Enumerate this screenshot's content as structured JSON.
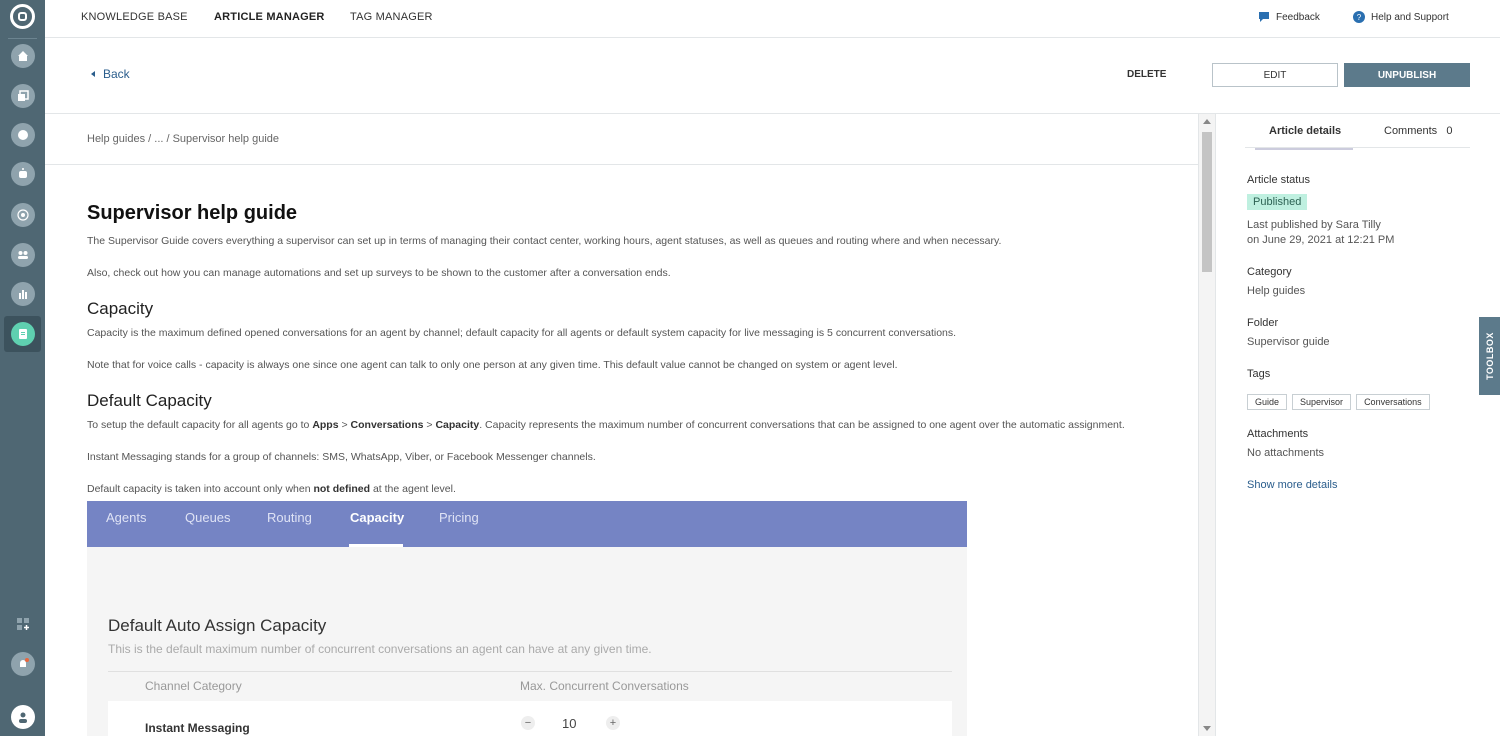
{
  "nav": {
    "tabs": [
      "KNOWLEDGE BASE",
      "ARTICLE MANAGER",
      "TAG MANAGER"
    ],
    "feedback": "Feedback",
    "help": "Help and Support"
  },
  "actions": {
    "back": "Back",
    "delete": "DELETE",
    "edit": "EDIT",
    "unpublish": "UNPUBLISH"
  },
  "breadcrumb": "Help guides / ... / Supervisor help guide",
  "article": {
    "title": "Supervisor help guide",
    "intro1": "The Supervisor Guide covers everything a supervisor can set up in terms of managing their contact center, working hours, agent statuses, as well as queues and routing where and when necessary.",
    "intro2": "Also, check out how you can manage automations and set up surveys to be shown to the customer after a conversation ends.",
    "h_capacity": "Capacity",
    "cap1": "Capacity is the maximum defined opened conversations for an agent by channel; default capacity for all agents or default system capacity for live messaging is 5 concurrent conversations.",
    "cap2": "Note that for voice calls - capacity is always one since one agent can talk to only one person at any given time. This default value cannot be changed on system or agent level.",
    "h_default": "Default Capacity",
    "def1_a": "To setup the default capacity for all agents go to ",
    "def1_apps": "Apps",
    "def1_gt1": " > ",
    "def1_conv": "Conversations",
    "def1_gt2": " > ",
    "def1_cap": "Capacity",
    "def1_b": ". Capacity represents the maximum number of concurrent conversations that can be assigned to one agent over the automatic assignment.",
    "def2": "Instant Messaging stands for a group of channels: SMS, WhatsApp, Viber, or Facebook Messenger channels.",
    "def3_a": "Default capacity is taken into account only when ",
    "def3_b": "not defined",
    "def3_c": " at the agent level."
  },
  "screenshot": {
    "tabs": [
      "Agents",
      "Queues",
      "Routing",
      "Capacity",
      "Pricing"
    ],
    "active_tab": "Capacity",
    "title": "Default Auto Assign Capacity",
    "subtitle": "This is the default maximum number of concurrent conversations an agent can have at any given time.",
    "col1": "Channel Category",
    "col2": "Max. Concurrent Conversations",
    "row_label": "Instant Messaging",
    "row_value": "10",
    "minus": "−",
    "plus": "+"
  },
  "panel": {
    "tab_details": "Article details",
    "tab_comments": "Comments",
    "comments_count": "0",
    "status_label": "Article status",
    "status": "Published",
    "published_by": "Last published by Sara Tilly",
    "published_on": "on June 29, 2021 at 12:21 PM",
    "category_label": "Category",
    "category": "Help guides",
    "folder_label": "Folder",
    "folder": "Supervisor guide",
    "tags_label": "Tags",
    "tags": [
      "Guide",
      "Supervisor",
      "Conversations"
    ],
    "attachments_label": "Attachments",
    "attachments": "No attachments",
    "show_more": "Show more details"
  },
  "toolbox": "TOOLBOX",
  "colors": {
    "rail": "#4f6773",
    "accent": "#5c7a8b",
    "link": "#2a5d8c",
    "published_bg": "#bff0e0"
  },
  "rail_icons": [
    "home-icon",
    "copy-icon",
    "chat-icon",
    "bot-icon",
    "network-icon",
    "people-icon",
    "chart-icon",
    "article-icon",
    "apps-add-icon",
    "bell-icon",
    "user-avatar-icon"
  ]
}
